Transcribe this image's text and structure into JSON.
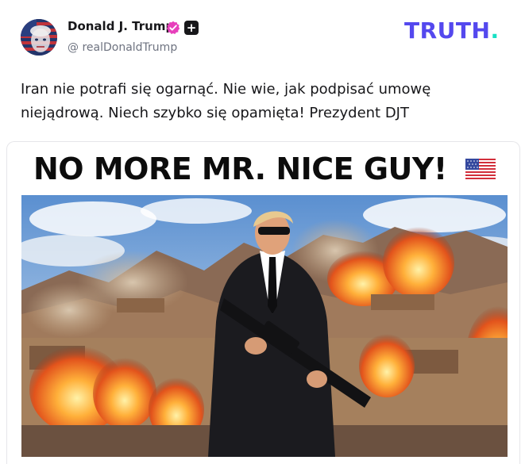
{
  "author": {
    "display_name": "Donald J. Trump",
    "handle": "@ realDonaldTrump",
    "verified": true,
    "avatar_icon": "avatar-portrait-flag"
  },
  "brand": {
    "logo_text": "TRUTH",
    "logo_dot": ".",
    "logo_color": "#5448ee",
    "dot_color": "#17e0c4"
  },
  "post": {
    "text": "Iran nie potrafi się ogarnąć. Nie wie, jak podpisać umowę niejądrową. Niech szybko się opamięta! Prezydent DJT",
    "headline": "NO MORE MR. NICE GUY!",
    "headline_icon": "us-flag-icon",
    "image_description_icon": "photo-image"
  },
  "colors": {
    "text": "#17171a",
    "muted": "#6e7380",
    "verified_badge": "#e73fbb"
  }
}
